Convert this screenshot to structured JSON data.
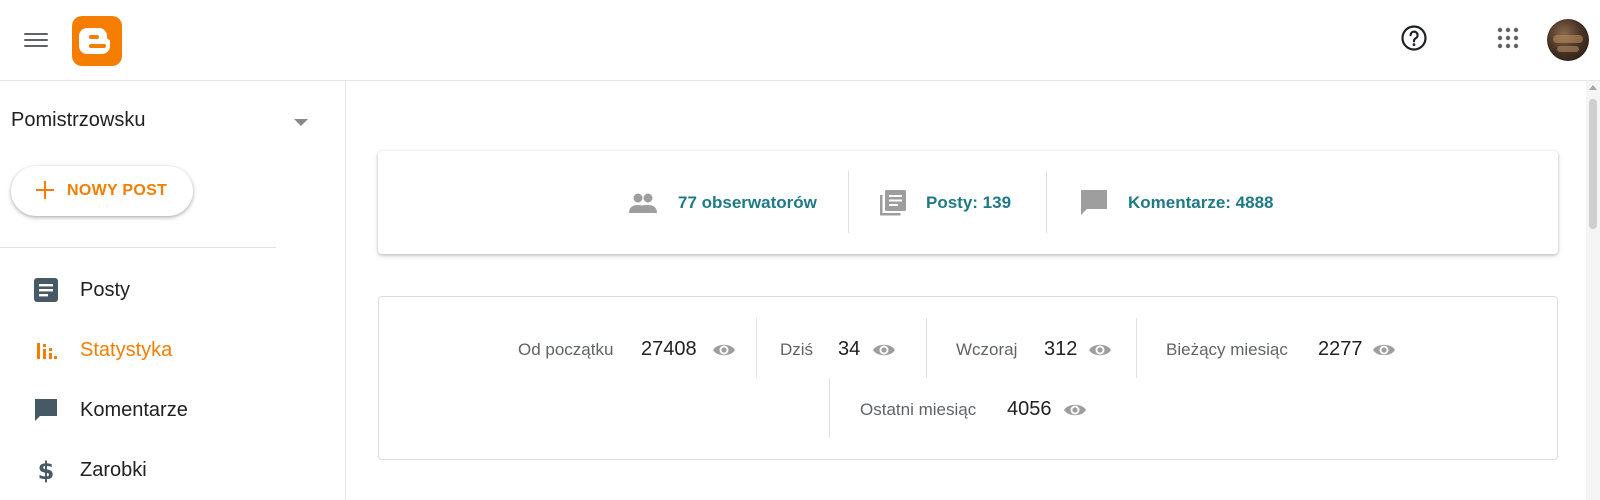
{
  "header": {
    "menu_icon": "hamburger-menu-icon",
    "logo_icon": "blogger-logo-icon",
    "help_icon": "help-circle-icon",
    "apps_icon": "apps-grid-icon",
    "avatar_icon": "user-avatar",
    "accent_color": "#f57d00"
  },
  "sidebar": {
    "blog_name": "Pomistrzowsku",
    "new_post_label": "NOWY POST",
    "items": [
      {
        "label": "Posty",
        "icon": "posts-icon",
        "active": false
      },
      {
        "label": "Statystyka",
        "icon": "stats-icon",
        "active": true
      },
      {
        "label": "Komentarze",
        "icon": "comments-icon",
        "active": false
      },
      {
        "label": "Zarobki",
        "icon": "dollar-icon",
        "active": false
      }
    ]
  },
  "summary": {
    "followers": "77 obserwatorów",
    "posts": "Posty: 139",
    "comments": "Komentarze: 4888",
    "link_color": "#1f7a87"
  },
  "views": [
    {
      "label": "Od początku",
      "value": "27408"
    },
    {
      "label": "Dziś",
      "value": "34"
    },
    {
      "label": "Wczoraj",
      "value": "312"
    },
    {
      "label": "Bieżący miesiąc",
      "value": "2277"
    },
    {
      "label": "Ostatni miesiąc",
      "value": "4056"
    }
  ]
}
